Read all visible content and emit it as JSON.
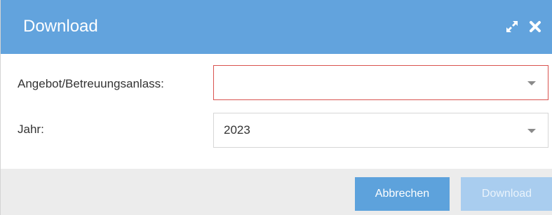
{
  "dialog": {
    "title": "Download",
    "expand_icon": "expand-arrows-icon",
    "close_icon": "close-x-icon",
    "header_color": "#62a3dd"
  },
  "form": {
    "offer_label": "Angebot/Betreuungsanlass:",
    "offer_value": "",
    "offer_state": "invalid",
    "year_label": "Jahr:",
    "year_value": "2023"
  },
  "footer": {
    "cancel_label": "Abbrechen",
    "download_label": "Download",
    "download_enabled": false
  }
}
